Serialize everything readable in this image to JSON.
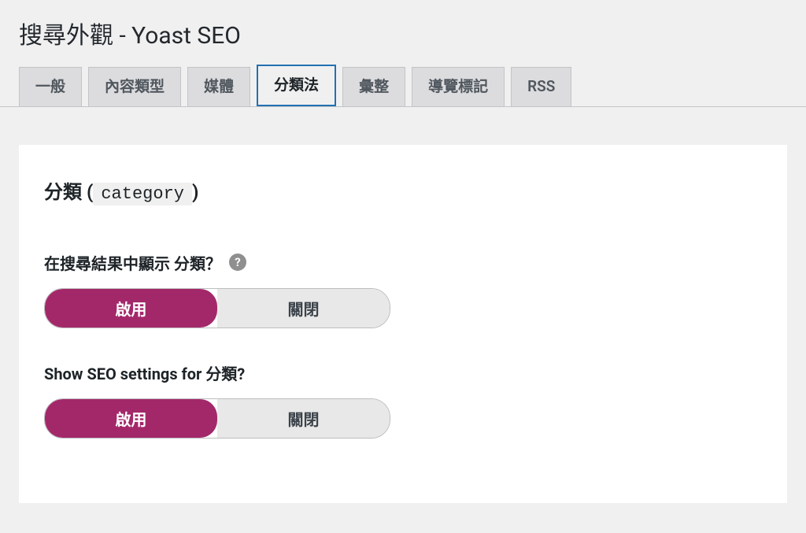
{
  "page": {
    "title": "搜尋外觀 - Yoast SEO"
  },
  "tabs": [
    {
      "label": "一般",
      "active": false
    },
    {
      "label": "內容類型",
      "active": false
    },
    {
      "label": "媒體",
      "active": false
    },
    {
      "label": "分類法",
      "active": true
    },
    {
      "label": "彙整",
      "active": false
    },
    {
      "label": "導覽標記",
      "active": false
    },
    {
      "label": "RSS",
      "active": false
    }
  ],
  "section": {
    "heading_prefix": "分類 (",
    "heading_code": "category",
    "heading_suffix": ")"
  },
  "settings": {
    "show_in_search": {
      "label": "在搜尋結果中顯示 分類？",
      "help": "?",
      "option_on": "啟用",
      "option_off": "關閉",
      "value": "on"
    },
    "show_seo_settings": {
      "label": "Show SEO settings for 分類?",
      "option_on": "啟用",
      "option_off": "關閉",
      "value": "on"
    }
  }
}
